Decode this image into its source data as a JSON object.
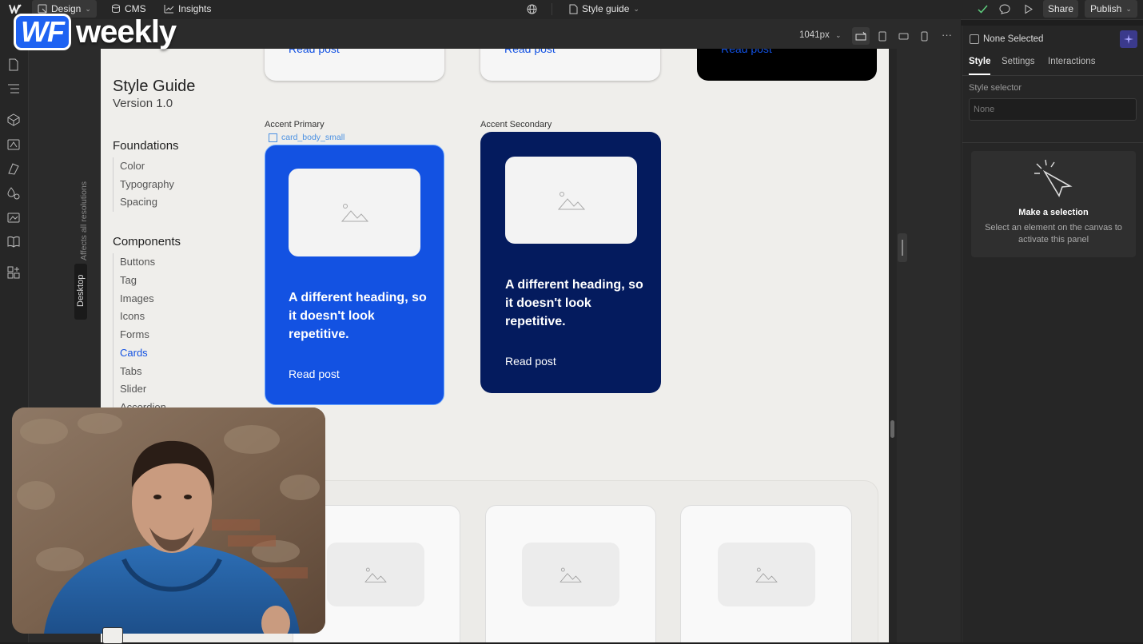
{
  "topbar": {
    "design": "Design",
    "cms": "CMS",
    "insights": "Insights",
    "page_name": "Style guide",
    "share": "Share",
    "publish": "Publish"
  },
  "canvas": {
    "width_label": "1041px",
    "side_label_all": "Affects all resolutions",
    "side_label_desktop": "Desktop"
  },
  "style_guide": {
    "title": "Style Guide",
    "version": "Version 1.0",
    "foundations": {
      "heading": "Foundations",
      "items": [
        "Color",
        "Typography",
        "Spacing"
      ]
    },
    "components": {
      "heading": "Components",
      "items": [
        "Buttons",
        "Tag",
        "Images",
        "Icons",
        "Forms",
        "Cards",
        "Tabs",
        "Slider",
        "Accordion"
      ],
      "active": "Cards"
    }
  },
  "top_cards": {
    "link_1": "Read post",
    "link_2": "Read post",
    "link_3": "Read post"
  },
  "cards": {
    "primary": {
      "caption": "Accent Primary",
      "selection_label": "card_body_small",
      "heading": "A different heading, so it doesn't look repetitive.",
      "link": "Read post",
      "color": "#1352e2"
    },
    "secondary": {
      "caption": "Accent Secondary",
      "heading": "A different heading, so it doesn't look repetitive.",
      "link": "Read post",
      "color": "#041b5e"
    }
  },
  "right_panel": {
    "none_selected": "None Selected",
    "tabs": [
      "Style",
      "Settings",
      "Interactions"
    ],
    "active_tab": "Style",
    "style_selector_label": "Style selector",
    "style_selector_placeholder": "None",
    "empty_title": "Make a selection",
    "empty_desc": "Select an element on the canvas to activate this panel"
  },
  "logo": {
    "wf": "WF",
    "weekly": "weekly"
  },
  "colors": {
    "accent_blue": "#1352e2",
    "navy": "#041b5e",
    "selection": "#4a90e2",
    "ui_dark": "#262626"
  }
}
